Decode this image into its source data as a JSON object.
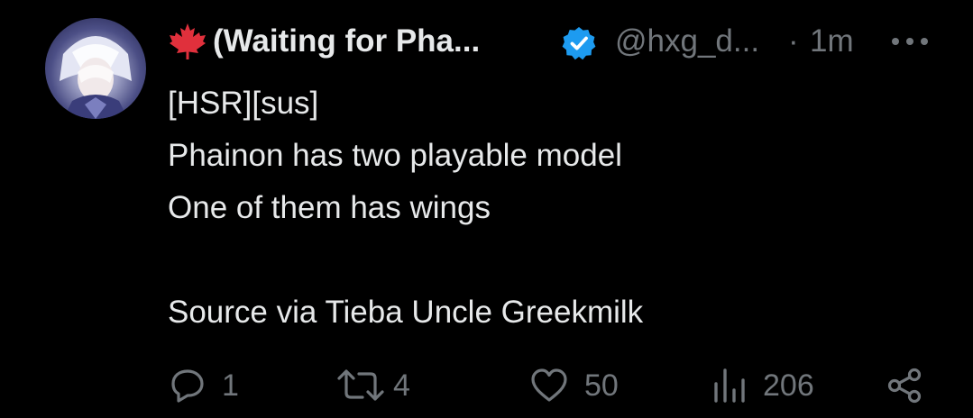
{
  "tweet": {
    "author": {
      "display_name": "(Waiting for Pha...",
      "handle": "@hxg_d...",
      "verified": true,
      "flag_icon": "maple-leaf-icon",
      "avatar": "avatar-image"
    },
    "separator": "·",
    "time": "1m",
    "body_lines": [
      "[HSR][sus]",
      "Phainon has two playable model",
      "One of them has wings",
      "",
      "Source via Tieba Uncle Greekmilk"
    ],
    "actions": {
      "replies": "1",
      "reposts": "4",
      "likes": "50",
      "views": "206"
    }
  },
  "colors": {
    "background": "#000000",
    "primary_text": "#e7e9ea",
    "secondary_text": "#71767b",
    "verified_badge": "#1d9bf0",
    "flag": "#e0303c"
  },
  "icons": {
    "more": "more-icon",
    "reply": "reply-icon",
    "repost": "repost-icon",
    "like": "heart-icon",
    "views": "views-icon",
    "share": "share-icon"
  }
}
